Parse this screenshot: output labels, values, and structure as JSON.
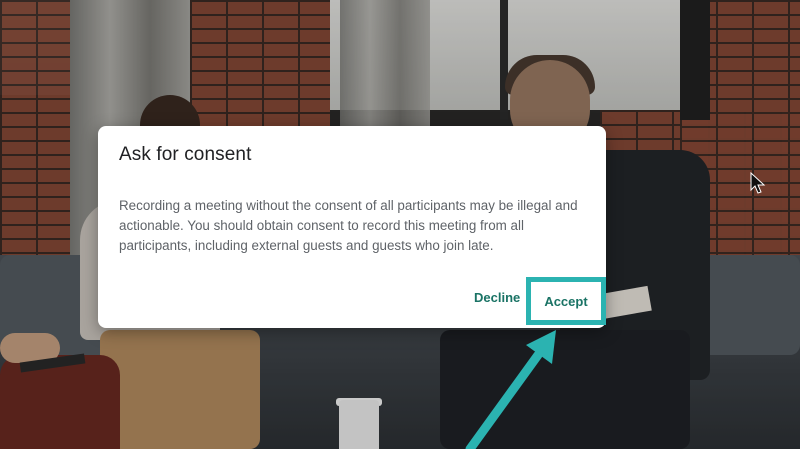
{
  "dialog": {
    "title": "Ask for consent",
    "message": "Recording a meeting without the consent of all participants may be illegal and actionable. You should obtain consent to record this meeting from all participants, including external guests and guests who join late.",
    "decline_label": "Decline",
    "accept_label": "Accept"
  },
  "annotation": {
    "highlight_color": "#2bb3b1",
    "arrow_color": "#2bb3b1"
  },
  "colors": {
    "button_text": "#1a7365",
    "title_text": "#202124",
    "body_text": "#5f6368"
  },
  "icons": {
    "cursor": "mouse-pointer-icon",
    "annotation_arrow": "arrow-up-right-icon"
  }
}
